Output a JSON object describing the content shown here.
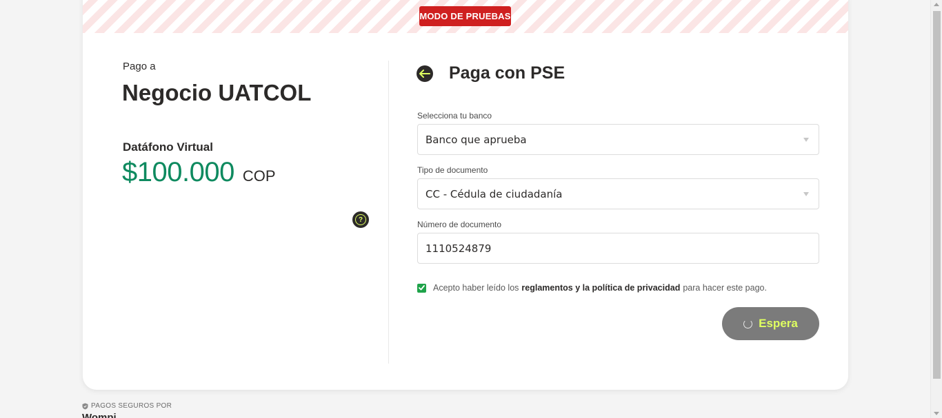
{
  "test_mode": {
    "label": "MODO DE PRUEBAS"
  },
  "summary": {
    "pay_to_label": "Pago a",
    "merchant_name": "Negocio UATCOL",
    "product_name": "Datáfono Virtual",
    "amount": "$100.000",
    "currency": "COP",
    "help_icon": "question-circle-icon"
  },
  "payment": {
    "title": "Paga con PSE",
    "back_icon": "arrow-left-icon",
    "bank": {
      "label": "Selecciona tu banco",
      "value": "Banco que aprueba"
    },
    "doc_type": {
      "label": "Tipo de documento",
      "value": "CC - Cédula de ciudadanía"
    },
    "doc_number": {
      "label": "Número de documento",
      "value": "1110524879"
    },
    "consent": {
      "checked": true,
      "prefix": "Acepto haber leído los",
      "link": "reglamentos y la política de privacidad",
      "suffix": "para hacer este pago."
    },
    "submit_label": "Espera"
  },
  "footer": {
    "secure_label": "PAGOS SEGUROS POR",
    "brand": "Wompi"
  },
  "colors": {
    "accent": "#dfff61",
    "amount_green": "#0e8a5f",
    "test_badge": "#cf2020",
    "checkbox": "#1fa34a",
    "button_disabled": "#7b7b7b"
  }
}
